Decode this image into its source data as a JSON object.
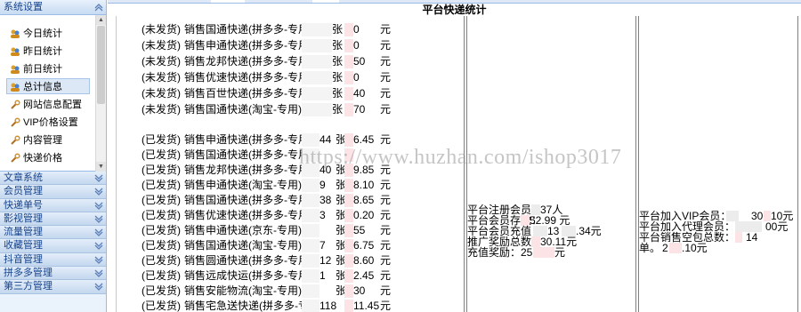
{
  "sidebar": {
    "panel_title": "系统设置",
    "items": [
      {
        "label": "今日统计",
        "icon": "user-group-icon"
      },
      {
        "label": "昨日统计",
        "icon": "user-group-icon"
      },
      {
        "label": "前日统计",
        "icon": "user-group-icon"
      },
      {
        "label": "总计信息",
        "icon": "user-group-icon",
        "active": true
      },
      {
        "label": "网站信息配置",
        "icon": "wrench-icon"
      },
      {
        "label": "VIP价格设置",
        "icon": "wrench-icon"
      },
      {
        "label": "内容管理",
        "icon": "wrench-icon"
      },
      {
        "label": "快递价格",
        "icon": "wrench-icon"
      }
    ],
    "sections": [
      "文章系统",
      "会员管理",
      "快递单号",
      "影视管理",
      "流量管理",
      "收藏管理",
      "抖音管理",
      "拼多多管理",
      "第三方管理"
    ]
  },
  "page": {
    "title": "平台快递统计"
  },
  "unshipped": [
    {
      "status": "(未发货)",
      "verb": "销售",
      "courier": "国通快递(拼多多-专用)",
      "count_suffix": "张",
      "amount_tail": "0",
      "unit": "元"
    },
    {
      "status": "(未发货)",
      "verb": "销售",
      "courier": "申通快递(拼多多-专用",
      "count_suffix": "张",
      "amount_tail": "0",
      "unit": "元"
    },
    {
      "status": "(未发货)",
      "verb": "销售",
      "courier": "龙邦快递(拼多多-专用",
      "count_suffix": "张",
      "amount_tail": "50",
      "unit": "元"
    },
    {
      "status": "(未发货)",
      "verb": "销售",
      "courier": "优速快递(拼多多-专用",
      "count_suffix": "张",
      "amount_tail": "0",
      "unit": "元"
    },
    {
      "status": "(未发货)",
      "verb": "销售",
      "courier": "百世快递(拼多多-专用",
      "count_suffix": "张",
      "amount_tail": "40",
      "unit": "元"
    },
    {
      "status": "(未发货)",
      "verb": "销售",
      "courier": "国通快递(淘宝-专用)",
      "count_suffix": "张",
      "amount_tail": "70",
      "unit": "元"
    }
  ],
  "shipped": [
    {
      "status": "(已发货)",
      "verb": "销售",
      "courier": "申通快递(拼多多-专用",
      "count": "44",
      "count_suffix": "张",
      "amount_tail": "6.45",
      "unit": "元"
    },
    {
      "status": "(已发货)",
      "verb": "销售",
      "courier": "国通快递(拼多多-专用",
      "count": "",
      "count_suffix": "",
      "amount_tail": "",
      "unit": ""
    },
    {
      "status": "(已发货)",
      "verb": "销售",
      "courier": "龙邦快递(拼多多-专用",
      "count": "40",
      "count_suffix": "张",
      "amount_tail": "9.85",
      "unit": "元"
    },
    {
      "status": "(已发货)",
      "verb": "销售",
      "courier": "申通快递(淘宝-专用)",
      "count": "9",
      "count_suffix": "张",
      "amount_tail": "8.10",
      "unit": "元"
    },
    {
      "status": "(已发货)",
      "verb": "销售",
      "courier": "国通快递(拼多多-专用",
      "count": "38",
      "count_suffix": "张",
      "amount_tail": "8.65",
      "unit": "元"
    },
    {
      "status": "(已发货)",
      "verb": "销售",
      "courier": "优速快递(拼多多-专用",
      "count": "3",
      "count_suffix": "张",
      "amount_tail": "0.20",
      "unit": "元"
    },
    {
      "status": "(已发货)",
      "verb": "销售",
      "courier": "申通快递(京东-专用)",
      "count": "",
      "count_suffix": "张",
      "amount_tail": "55",
      "unit": "元"
    },
    {
      "status": "(已发货)",
      "verb": "销售",
      "courier": "国通快递(淘宝-专用)",
      "count": "7",
      "count_suffix": "张",
      "amount_tail": "6.75",
      "unit": "元"
    },
    {
      "status": "(已发货)",
      "verb": "销售",
      "courier": "圆通快递(拼多多-专用",
      "count": "12",
      "count_suffix": "张",
      "amount_tail": "8.60",
      "unit": "元"
    },
    {
      "status": "(已发货)",
      "verb": "销售",
      "courier": "远成快运(拼多多-专用",
      "count": "1",
      "count_suffix": "张",
      "amount_tail": "2.45",
      "unit": "元"
    },
    {
      "status": "(已发货)",
      "verb": "销售",
      "courier": "安能物流(淘宝-专用)",
      "count": "",
      "count_suffix": "张",
      "amount_tail": "30",
      "unit": "元"
    },
    {
      "status": "(已发货)",
      "verb": "销售",
      "courier": "宅急送快递(拼多多-专",
      "count": "118",
      "count_suffix": "",
      "amount_tail": "11.45",
      "unit": "元"
    }
  ],
  "members": [
    {
      "label": "平台注册会员：",
      "value": "37人"
    },
    {
      "label": "平台会员存款：",
      "value": "52.99 元"
    },
    {
      "label": "平台会员充值",
      "value": "13",
      "value2": ".34元"
    },
    {
      "label": "推广奖励总数",
      "value": "30.11元"
    },
    {
      "label": "充值奖励：",
      "value": "25",
      "value2": "元"
    }
  ],
  "agents": [
    {
      "label": "平台加入VIP会员：",
      "value": "30",
      "value2": "10元"
    },
    {
      "label": "平台加入代理会员：",
      "value": "00元"
    },
    {
      "label": "平台销售空包总数：",
      "value": "14"
    },
    {
      "label": "单。",
      "value": "2",
      "value2": ".10元"
    }
  ],
  "watermark": "https://www.huzhan.com/ishop3017"
}
